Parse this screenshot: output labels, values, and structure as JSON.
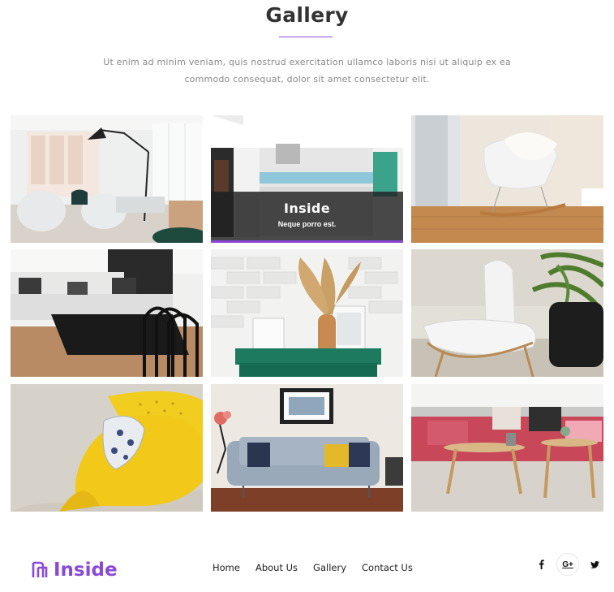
{
  "header": {
    "title": "Gallery",
    "description": "Ut enim ad minim veniam, quis nostrud exercitation ullamco laboris nisi ut aliquip ex ea commodo consequat, dolor sit amet consectetur elit."
  },
  "gallery": {
    "active_overlay": {
      "title": "Inside",
      "subtitle": "Neque porro est."
    },
    "items": [
      {
        "subject": "living room with lamp"
      },
      {
        "subject": "kitchen"
      },
      {
        "subject": "white rocking chair"
      },
      {
        "subject": "sofa with coffee table"
      },
      {
        "subject": "dried plant vase on green console"
      },
      {
        "subject": "white chair with palm"
      },
      {
        "subject": "yellow armchair"
      },
      {
        "subject": "grey sofa with framed picture"
      },
      {
        "subject": "pink sofa with wooden tables"
      }
    ]
  },
  "footer": {
    "brand": "Inside",
    "nav": [
      {
        "label": "Home"
      },
      {
        "label": "About Us"
      },
      {
        "label": "Gallery"
      },
      {
        "label": "Contact Us"
      }
    ],
    "social": {
      "facebook": "f",
      "google_plus": "G+",
      "twitter": "t"
    }
  },
  "colors": {
    "accent": "#8a4ad8",
    "text": "#333333",
    "muted": "#8a8a8a"
  }
}
